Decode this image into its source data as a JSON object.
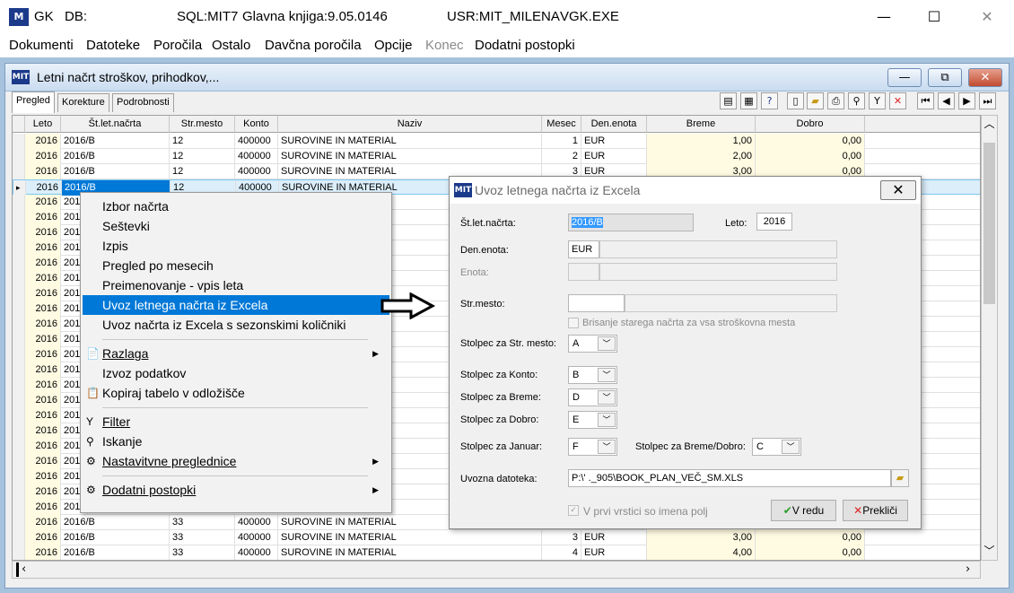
{
  "titlebar": {
    "app": "GK",
    "db": "DB:",
    "sql": "SQL:MIT7",
    "book": "Glavna knjiga:9.05.0146",
    "user": "USR:MIT_MILENA",
    "exe": "VGK.EXE",
    "minimize": "—",
    "maximize": "☐",
    "close": "✕"
  },
  "menu": [
    "Dokumenti",
    "Datoteke",
    "Poročila",
    "Ostalo",
    "Davčna poročila",
    "Opcije",
    "Konec",
    "Dodatni postopki"
  ],
  "child": {
    "title": "Letni načrt stroškov, prihodkov,...",
    "logo": "MIT",
    "tabs": [
      "Pregled",
      "Korekture",
      "Podrobnosti"
    ]
  },
  "grid": {
    "headers": [
      "Leto",
      "Št.let.načrta",
      "Str.mesto",
      "Konto",
      "Naziv",
      "Mesec",
      "Den.enota",
      "Breme",
      "Dobro"
    ],
    "rows": [
      [
        "2016",
        "2016/B",
        "12",
        "400000",
        "SUROVINE IN MATERIAL",
        "1",
        "EUR",
        "1,00",
        "0,00"
      ],
      [
        "2016",
        "2016/B",
        "12",
        "400000",
        "SUROVINE IN MATERIAL",
        "2",
        "EUR",
        "2,00",
        "0,00"
      ],
      [
        "2016",
        "2016/B",
        "12",
        "400000",
        "SUROVINE IN MATERIAL",
        "3",
        "EUR",
        "3,00",
        "0,00"
      ],
      [
        "2016",
        "2016/B",
        "12",
        "400000",
        "SUROVINE IN MATERIAL",
        "",
        "",
        "",
        ""
      ]
    ],
    "left_rows": [
      "2016",
      "2016",
      "2016",
      "2016",
      "2016",
      "2016",
      "2016",
      "2016",
      "2016",
      "2016",
      "2016",
      "2016",
      "2016",
      "2016",
      "2016",
      "2016",
      "2016",
      "2016",
      "2016",
      "2016",
      "2016"
    ],
    "left_rows_num": "201",
    "bottom_rows": [
      [
        "2016",
        "2016/B",
        "33",
        "400000",
        "SUROVINE IN MATERIAL",
        "",
        "",
        "",
        ""
      ],
      [
        "2016",
        "2016/B",
        "33",
        "400000",
        "SUROVINE IN MATERIAL",
        "3",
        "EUR",
        "3,00",
        "0,00"
      ],
      [
        "2016",
        "2016/B",
        "33",
        "400000",
        "SUROVINE IN MATERIAL",
        "4",
        "EUR",
        "4,00",
        "0,00"
      ]
    ]
  },
  "context_menu": {
    "items": [
      "Izbor načrta",
      "Seštevki",
      "Izpis",
      "Pregled po mesecih",
      "Preimenovanje - vpis leta",
      "Uvoz letnega načrta iz Excela",
      "Uvoz načrta iz Excela s sezonskimi količniki",
      "Razlaga",
      "Izvoz podatkov",
      "Kopiraj tabelo v odložišče",
      "Filter",
      "Iskanje",
      "Nastavitvne preglednice",
      "Dodatni postopki"
    ]
  },
  "dialog": {
    "title": "Uvoz letnega načrta iz Excela",
    "stletnacrta_label": "Št.let.načrta:",
    "stletnacrta_value": "2016/B",
    "leto_label": "Leto:",
    "leto_value": "2016",
    "denenota_label": "Den.enota:",
    "denenota_value": "EUR",
    "enota_label": "Enota:",
    "strmesto_label": "Str.mesto:",
    "brisanje_label": "Brisanje starega načrta za vsa stroškovna mesta",
    "stolpec_strmesto_label": "Stolpec za Str. mesto:",
    "stolpec_strmesto_value": "A",
    "stolpec_konto_label": "Stolpec za Konto:",
    "stolpec_konto_value": "B",
    "stolpec_breme_label": "Stolpec za Breme:",
    "stolpec_breme_value": "D",
    "stolpec_dobro_label": "Stolpec za Dobro:",
    "stolpec_dobro_value": "E",
    "stolpec_januar_label": "Stolpec za Januar:",
    "stolpec_januar_value": "F",
    "stolpec_bremedobro_label": "Stolpec za Breme/Dobro:",
    "stolpec_bremedobro_value": "C",
    "datoteka_label": "Uvozna datoteka:",
    "datoteka_value": "P:\\'            ._905\\BOOK_PLAN_VEČ_SM.XLS",
    "prvi_vrstici_label": "V prvi vrstici so imena polj",
    "ok_label": "V redu",
    "cancel_label": "Prekliči"
  }
}
